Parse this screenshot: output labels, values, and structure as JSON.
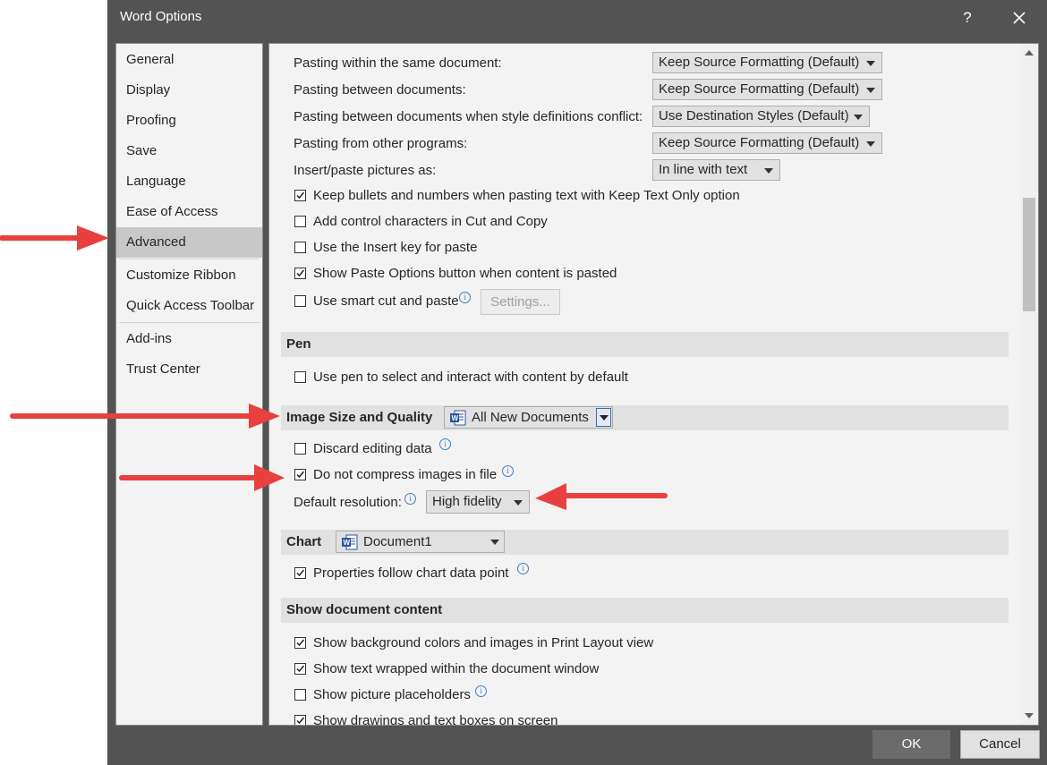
{
  "window": {
    "title": "Word Options",
    "help": "?"
  },
  "sidebar": {
    "items": [
      {
        "label": "General"
      },
      {
        "label": "Display"
      },
      {
        "label": "Proofing"
      },
      {
        "label": "Save"
      },
      {
        "label": "Language"
      },
      {
        "label": "Ease of Access"
      },
      {
        "label": "Advanced",
        "selected": true
      },
      {
        "label": "Customize Ribbon"
      },
      {
        "label": "Quick Access Toolbar"
      },
      {
        "label": "Add-ins"
      },
      {
        "label": "Trust Center"
      }
    ]
  },
  "paste": {
    "within": {
      "label": "Pasting within the same document:",
      "value": "Keep Source Formatting (Default)"
    },
    "between": {
      "label": "Pasting between documents:",
      "value": "Keep Source Formatting (Default)"
    },
    "conflict": {
      "label": "Pasting between documents when style definitions conflict:",
      "value": "Use Destination Styles (Default)"
    },
    "other": {
      "label": "Pasting from other programs:",
      "value": "Keep Source Formatting (Default)"
    },
    "pictures": {
      "label": "Insert/paste pictures as:",
      "value": "In line with text"
    },
    "keep_bullets": {
      "label": "Keep bullets and numbers when pasting text with Keep Text Only option",
      "checked": true
    },
    "control_chars": {
      "label": "Add control characters in Cut and Copy",
      "checked": false
    },
    "insert_key": {
      "label": "Use the Insert key for paste",
      "checked": false
    },
    "show_paste_options": {
      "label": "Show Paste Options button when content is pasted",
      "checked": true
    },
    "smart_cut": {
      "label": "Use smart cut and paste",
      "checked": false
    },
    "settings_button": "Settings..."
  },
  "pen": {
    "title": "Pen",
    "use_pen": {
      "label": "Use pen to select and interact with content by default",
      "checked": false
    }
  },
  "image": {
    "title": "Image Size and Quality",
    "document": "All New Documents",
    "discard": {
      "label": "Discard editing data",
      "checked": false
    },
    "no_compress": {
      "label": "Do not compress images in file",
      "checked": true
    },
    "resolution_label": "Default resolution:",
    "resolution_value": "High fidelity"
  },
  "chart": {
    "title": "Chart",
    "document": "Document1",
    "follow": {
      "label": "Properties follow chart data point",
      "checked": true
    }
  },
  "show_content": {
    "title": "Show document content",
    "background": {
      "label": "Show background colors and images in Print Layout view",
      "checked": true
    },
    "wrapped": {
      "label": "Show text wrapped within the document window",
      "checked": true
    },
    "placeholders": {
      "label": "Show picture placeholders",
      "checked": false
    },
    "drawings": {
      "label": "Show drawings and text boxes on screen",
      "checked": true
    }
  },
  "footer": {
    "ok": "OK",
    "cancel": "Cancel"
  },
  "colors": {
    "annotation_arrow": "#e8403f",
    "dialog_bg": "#535353",
    "panel_bg": "#f3f3f3"
  }
}
